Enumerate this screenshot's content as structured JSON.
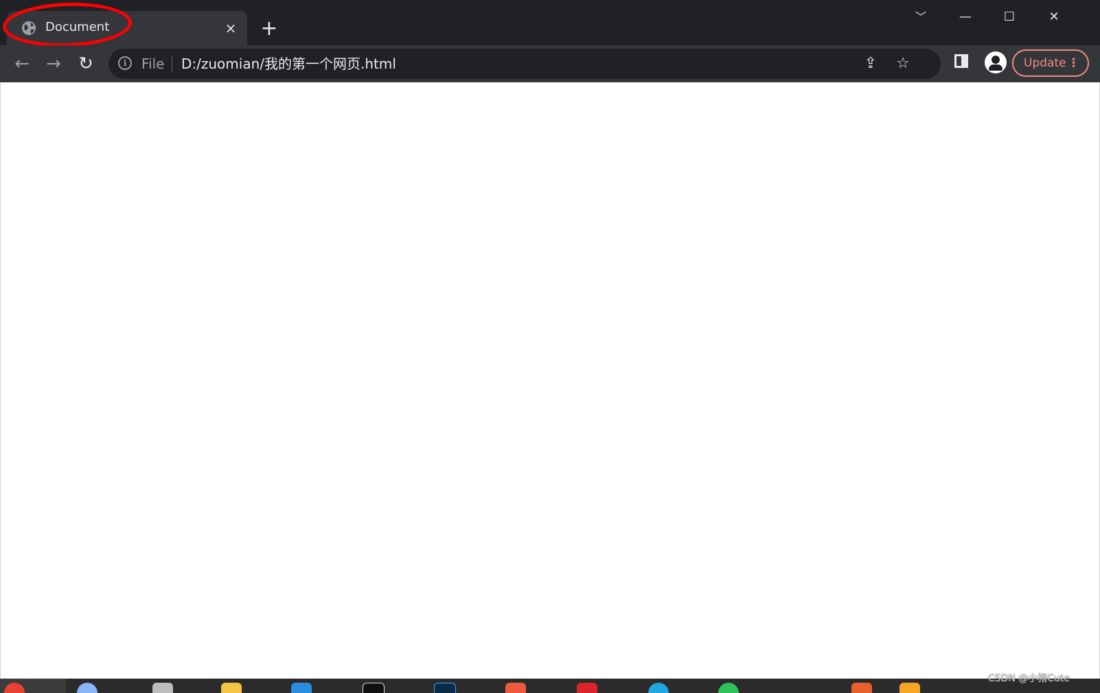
{
  "tab": {
    "title": "Document",
    "close_glyph": "×"
  },
  "new_tab_glyph": "+",
  "window_controls": {
    "tab_search_glyph": "﹀",
    "minimize_glyph": "—",
    "maximize_glyph": "☐",
    "close_glyph": "✕"
  },
  "nav": {
    "back_glyph": "←",
    "forward_glyph": "→",
    "reload_glyph": "↻"
  },
  "omnibox": {
    "scheme": "File",
    "url": "D:/zuomian/我的第一个网页.html",
    "share_glyph": "⇪",
    "bookmark_glyph": "☆"
  },
  "update_button": {
    "label": "Update",
    "menu_glyph": "⋮"
  },
  "watermark": "CSDN @小猪Cute",
  "colors": {
    "frame": "#202124",
    "toolbar": "#35363a",
    "annotation": "#ff0000",
    "update": "#f28b82"
  }
}
